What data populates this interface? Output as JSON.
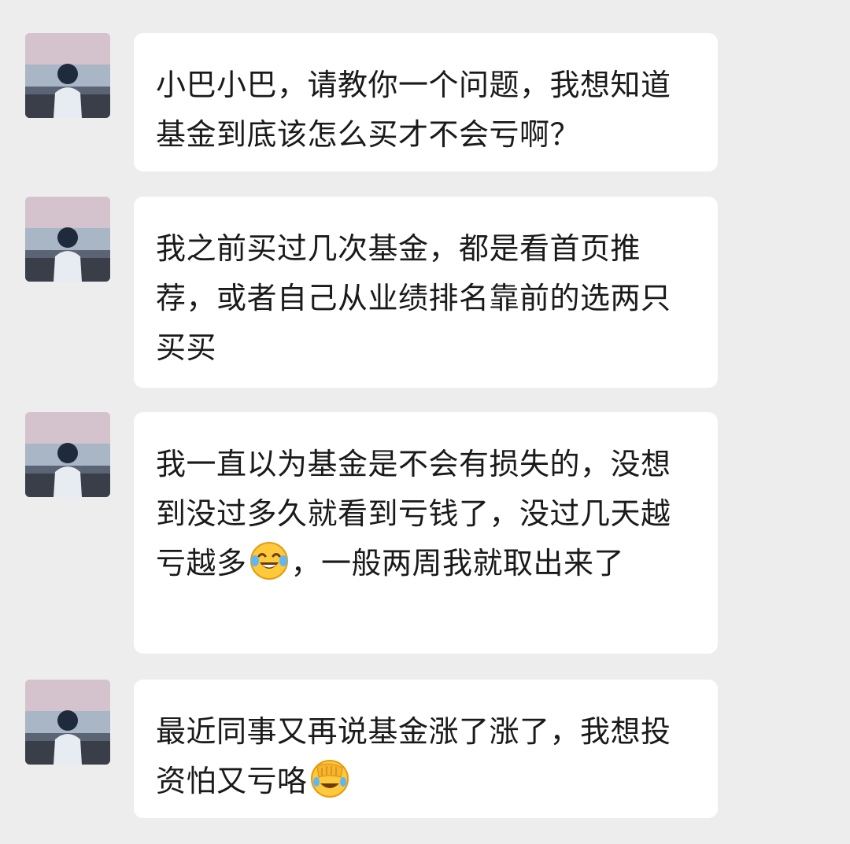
{
  "messages": [
    {
      "parts": [
        {
          "text": "小巴小巴，请教你一个问题，我想知道基金到底该怎么买才不会亏啊？"
        }
      ]
    },
    {
      "parts": [
        {
          "text": "我之前买过几次基金，都是看首页推荐，或者自己从业绩排名靠前的选两只买买"
        }
      ]
    },
    {
      "parts": [
        {
          "text": "我一直以为基金是不会有损失的，没想到没过多久就看到亏钱了，没过几天越亏越多"
        },
        {
          "emoji": "laughing-crying-emoji"
        },
        {
          "text": "，一般两周我就取出来了"
        }
      ]
    },
    {
      "parts": [
        {
          "text": "最近同事又再说基金涨了涨了，我想投资怕又亏咯"
        },
        {
          "emoji": "facepalm-crying-emoji"
        }
      ]
    }
  ]
}
